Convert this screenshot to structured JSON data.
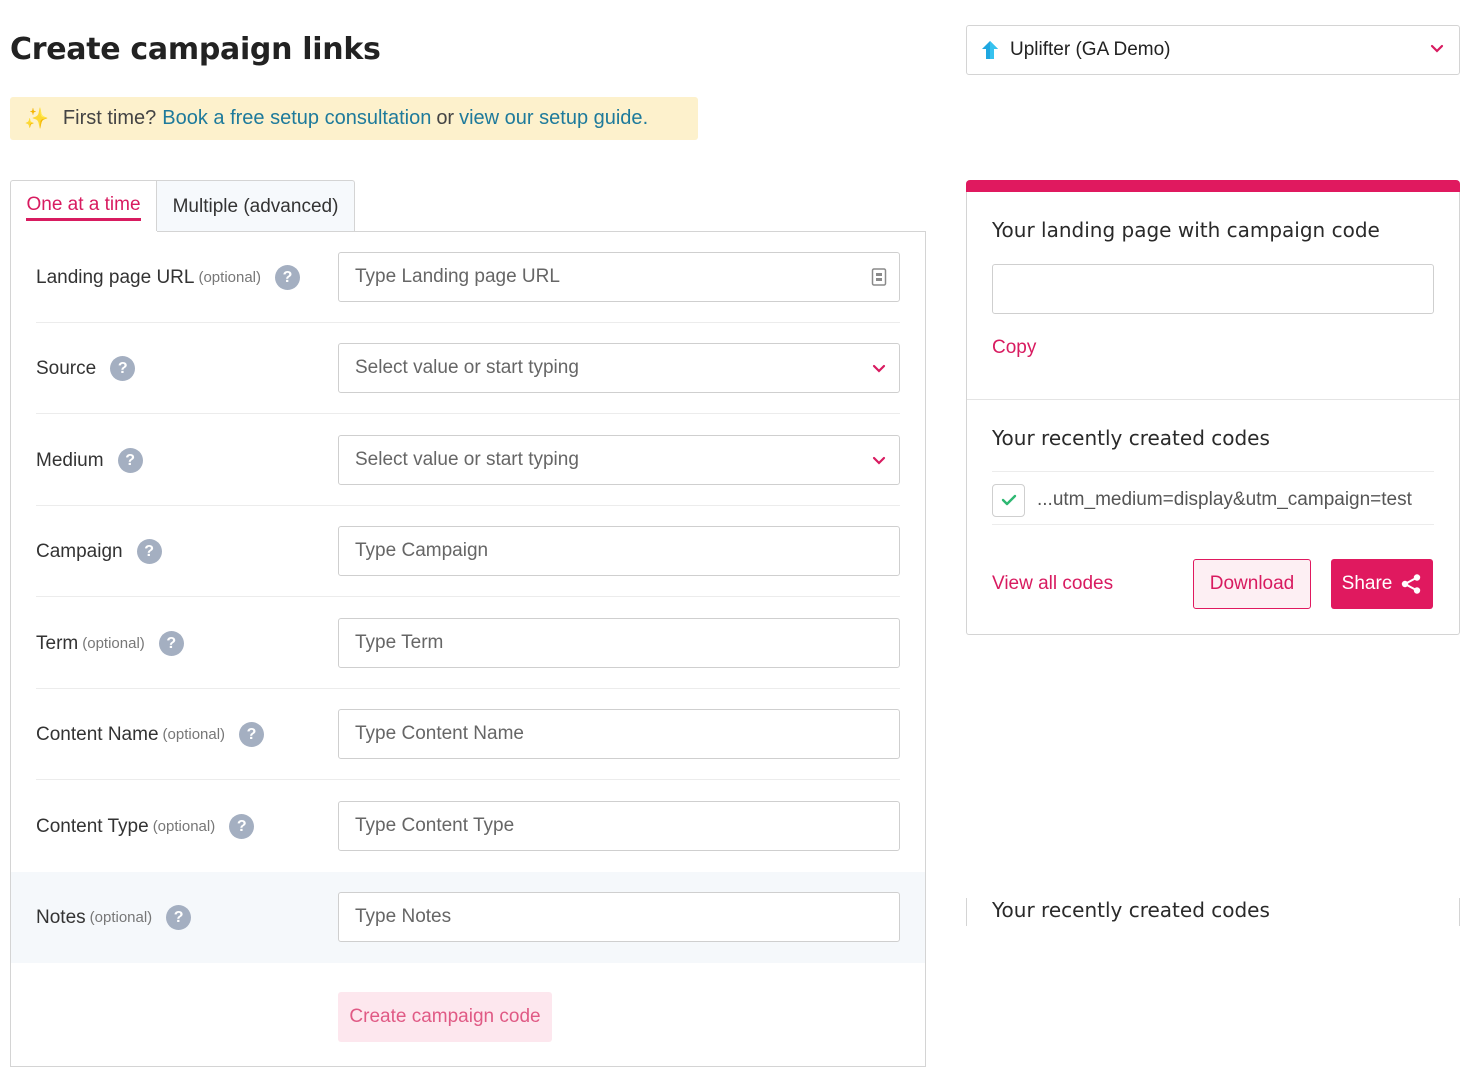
{
  "page": {
    "title": "Create campaign links"
  },
  "banner": {
    "prefix": "First time?",
    "link1": "Book a free setup consultation",
    "middle": "or",
    "link2": "view our setup guide",
    "suffix": "."
  },
  "account": {
    "name": "Uplifter (GA Demo)"
  },
  "tabs": [
    {
      "label": "One at a time",
      "active": true
    },
    {
      "label": "Multiple (advanced)",
      "active": false
    }
  ],
  "form": {
    "fields": [
      {
        "label": "Landing page URL",
        "optional": "(optional)",
        "placeholder": "Type Landing page URL",
        "kind": "text"
      },
      {
        "label": "Source",
        "optional": "",
        "placeholder": "Select value or start typing",
        "kind": "select"
      },
      {
        "label": "Medium",
        "optional": "",
        "placeholder": "Select value or start typing",
        "kind": "select"
      },
      {
        "label": "Campaign",
        "optional": "",
        "placeholder": "Type Campaign",
        "kind": "text"
      },
      {
        "label": "Term",
        "optional": "(optional)",
        "placeholder": "Type Term",
        "kind": "text"
      },
      {
        "label": "Content Name",
        "optional": "(optional)",
        "placeholder": "Type Content Name",
        "kind": "text"
      },
      {
        "label": "Content Type",
        "optional": "(optional)",
        "placeholder": "Type Content Type",
        "kind": "text"
      },
      {
        "label": "Notes",
        "optional": "(optional)",
        "placeholder": "Type Notes",
        "kind": "text"
      }
    ],
    "help_glyph": "?",
    "submit_label": "Create campaign code"
  },
  "result": {
    "heading": "Your landing page with campaign code",
    "output_value": "",
    "copy_label": "Copy",
    "recent_heading": "Your recently created codes",
    "recent_codes": [
      {
        "text": "...utm_medium=display&utm_campaign=test",
        "checked": true
      }
    ],
    "view_all_label": "View all codes",
    "download_label": "Download",
    "share_label": "Share"
  },
  "recent_duplicate": {
    "heading": "Your recently created codes"
  },
  "colors": {
    "accent": "#e0195f",
    "link": "#1e7a9b",
    "banner_bg": "#fdf1cc",
    "help_icon": "#a4afc1",
    "check": "#2eb872"
  }
}
